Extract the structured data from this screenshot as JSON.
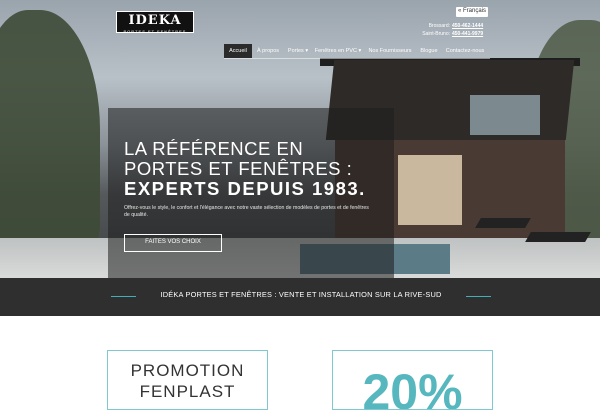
{
  "logo": {
    "name": "IDEKA",
    "tagline": "PORTES ET FENÊTRES"
  },
  "language_button": "« Français",
  "phones": [
    {
      "label": "Brossard:",
      "number": "450-462-1444"
    },
    {
      "label": "Saint-Bruno:",
      "number": "450-441-9979"
    }
  ],
  "nav": {
    "items": [
      {
        "label": "Accueil",
        "active": true
      },
      {
        "label": "À propos"
      },
      {
        "label": "Portes ▾"
      },
      {
        "label": "Fenêtres en PVC ▾"
      },
      {
        "label": "Nos Fournisseurs"
      },
      {
        "label": "Blogue"
      },
      {
        "label": "Contactez-nous"
      }
    ]
  },
  "hero": {
    "line1": "LA RÉFÉRENCE EN",
    "line2": "PORTES ET FENÊTRES :",
    "line3": "EXPERTS DEPUIS 1983.",
    "tagline": "Offrez-vous le style, le confort et l'élégance avec notre vaste sélection de modèles de portes et de fenêtres de qualité.",
    "cta": "FAITES VOS CHOIX"
  },
  "band": {
    "text": "IDÉKA PORTES ET FENÊTRES : VENTE ET INSTALLATION SUR LA RIVE-SUD"
  },
  "cards": [
    {
      "line1": "PROMOTION",
      "line2": "FENPLAST"
    },
    {
      "value": "20%"
    }
  ],
  "colors": {
    "accent": "#56b7bf",
    "dark_band": "#2f2f2f",
    "card_border": "#7ec9cf"
  }
}
